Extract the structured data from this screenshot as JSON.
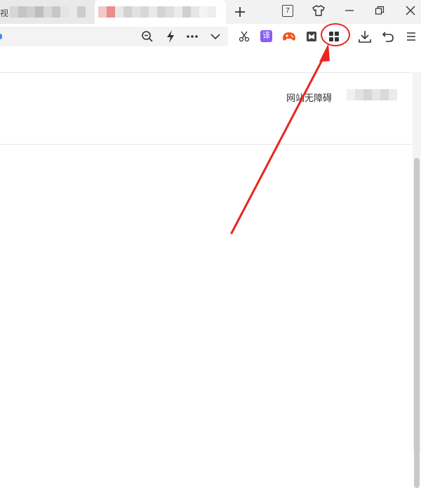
{
  "tabs": [
    {
      "title": "视",
      "state": "inactive"
    },
    {
      "title": "",
      "state": "active"
    }
  ],
  "tab_actions": {
    "new_tab_icon": "plus-icon"
  },
  "window_controls": {
    "tab_count": "7",
    "skin_icon": "tshirt-icon",
    "minimize_icon": "minimize-icon",
    "restore_icon": "restore-icon",
    "close_icon": "close-icon"
  },
  "address_bar": {
    "zoom_icon": "zoom-out-icon",
    "speed_icon": "lightning-icon",
    "more_icon": "more-icon",
    "dropdown_icon": "chevron-down-icon"
  },
  "extensions": {
    "screenshot_icon": "scissors-icon",
    "translate_label": "译",
    "game_icon": "gamepad-icon",
    "reader_icon": "reader-icon",
    "apps_icon": "apps-grid-icon",
    "download_icon": "download-icon",
    "undo_icon": "undo-icon",
    "menu_icon": "menu-icon"
  },
  "page": {
    "accessibility_link": "网站无障碍"
  },
  "colors": {
    "annotation": "#e8261f",
    "accent": "#3b8ee8",
    "translate_badge": "#8a5cf6",
    "game_icon": "#f2561d"
  }
}
